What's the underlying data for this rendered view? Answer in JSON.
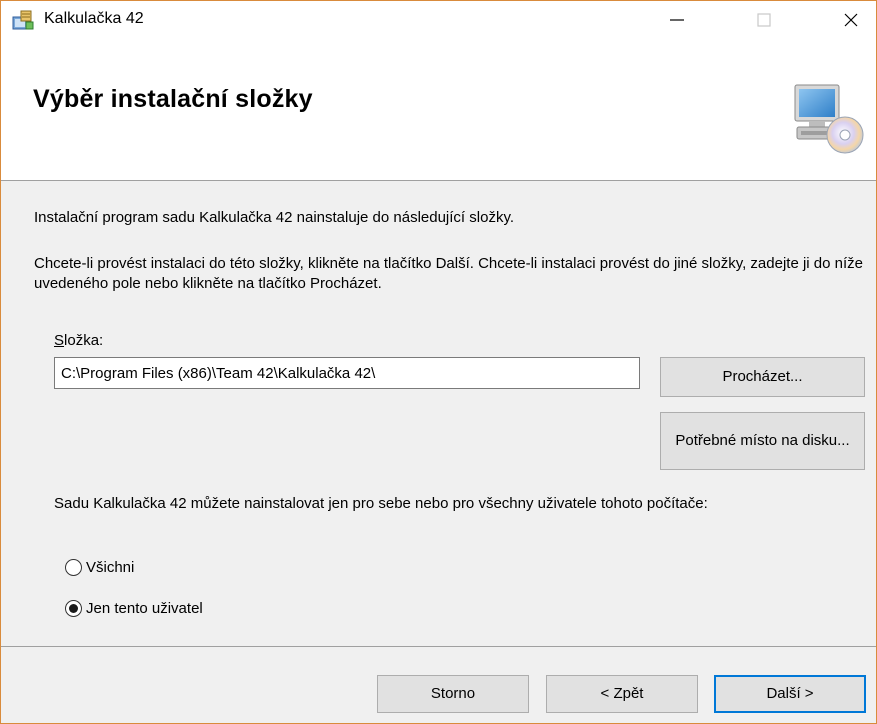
{
  "window": {
    "title": "Kalkulačka 42"
  },
  "header": {
    "title": "Výběr instalační složky"
  },
  "body": {
    "intro": "Instalační program sadu Kalkulačka 42 nainstaluje do následující složky.",
    "instructions": "Chcete-li provést instalaci do této složky, klikněte na tlačítko Další. Chcete-li instalaci provést do jiné složky, zadejte ji do níže uvedeného pole nebo klikněte na tlačítko Procházet.",
    "folder_label_mnemonic": "S",
    "folder_label_rest": "ložka:",
    "folder_value": "C:\\Program Files (x86)\\Team 42\\Kalkulačka 42\\",
    "browse_label": "Procházet...",
    "disk_space_label": "Potřebné místo na disku...",
    "users_text": "Sadu Kalkulačka 42 můžete nainstalovat jen pro sebe nebo pro všechny uživatele tohoto počítače:",
    "radio_all": "Všichni",
    "radio_me": "Jen tento uživatel",
    "selected_option": "radio_me"
  },
  "footer": {
    "cancel_label": "Storno",
    "back_label": "< Zpět",
    "next_label": "Další >"
  },
  "colors": {
    "window_border": "#d98b3c",
    "focus_border": "#0078d7",
    "dialog_bg": "#f0f0f0"
  },
  "icons": {
    "app": "installer-icon",
    "header": "computer-disc-icon"
  }
}
